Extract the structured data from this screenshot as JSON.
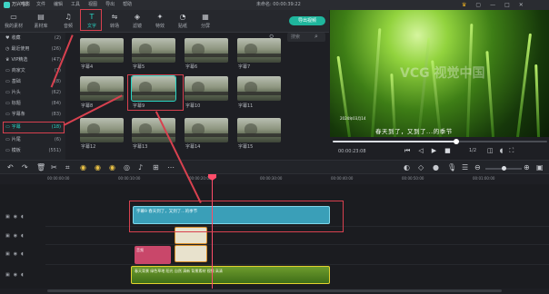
{
  "app": {
    "name": "万兴喵影",
    "window_title": "未命名: 00:00:39:22"
  },
  "menu": [
    "文件",
    "编辑",
    "工具",
    "视图",
    "导出",
    "帮助"
  ],
  "tabs": [
    {
      "label": "我的素材",
      "icon": "folder-icon"
    },
    {
      "label": "素材库",
      "icon": "media-icon"
    },
    {
      "label": "音频",
      "icon": "music-icon"
    },
    {
      "label": "文字",
      "icon": "text-icon",
      "active": true
    },
    {
      "label": "转场",
      "icon": "transition-icon"
    },
    {
      "label": "滤镜",
      "icon": "filter-icon"
    },
    {
      "label": "特效",
      "icon": "effects-icon"
    },
    {
      "label": "贴纸",
      "icon": "sticker-icon"
    },
    {
      "label": "分屏",
      "icon": "split-icon"
    }
  ],
  "sidebar": [
    {
      "label": "收藏",
      "count": "(2)"
    },
    {
      "label": "最近使用",
      "count": "(26)"
    },
    {
      "label": "VIP精选",
      "count": "(47)"
    },
    {
      "label": "商家文",
      "count": "(1)"
    },
    {
      "label": "基础",
      "count": "(8)"
    },
    {
      "label": "片头",
      "count": "(62)"
    },
    {
      "label": "标题",
      "count": "(84)"
    },
    {
      "label": "字幕条",
      "count": "(83)"
    },
    {
      "label": "字幕",
      "count": "(18)",
      "active": true
    },
    {
      "label": "片尾",
      "count": "(6)"
    },
    {
      "label": "模板",
      "count": "(551)"
    }
  ],
  "search": {
    "placeholder": "搜索"
  },
  "export_button": "导出视频",
  "thumbnails": [
    "字幕4",
    "字幕5",
    "字幕6",
    "字幕7",
    "字幕8",
    "字幕9",
    "字幕10",
    "字幕11",
    "字幕12",
    "字幕13",
    "字幕14",
    "字幕15"
  ],
  "preview": {
    "subtitle": "春天到了，又到了...的季节",
    "timestamp": "2024年03月14",
    "watermark": "VCG 视觉中国",
    "timecode": "00:00:23:08",
    "page": "1/2"
  },
  "ruler": [
    "00:00:00:00",
    "00:00:10:00",
    "00:00:20:00",
    "00:00:30:00",
    "00:00:40:00",
    "00:00:50:00",
    "00:01:00:00"
  ],
  "clips": {
    "title": "字幕9 春天到了，又到了...的季节",
    "audio": "音频",
    "video": "春天背景 绿色草地 阳光 自然 清新 背景素材 视频 高清"
  },
  "colors": {
    "accent": "#28d5c4",
    "annotation": "#d8414f",
    "playhead": "#ff4d6a",
    "title_clip": "#3a9fb8"
  }
}
